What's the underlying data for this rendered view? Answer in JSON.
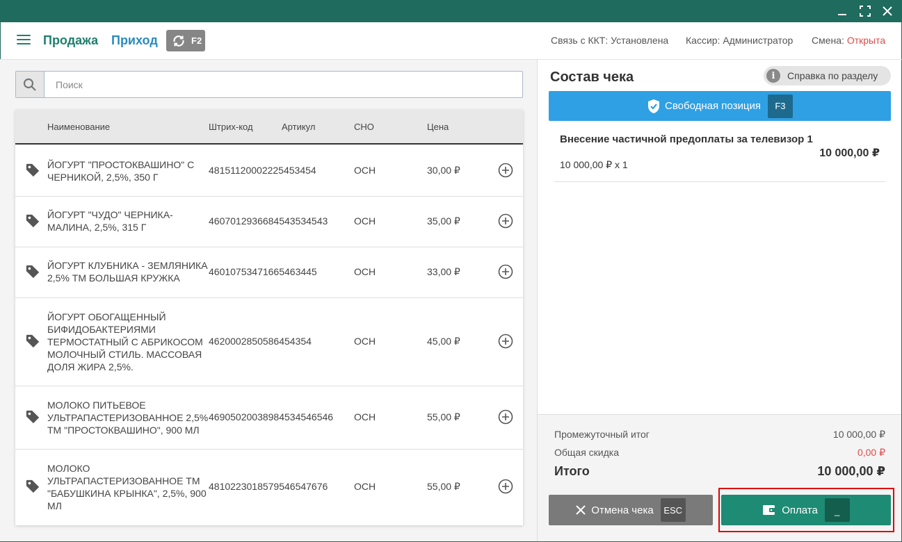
{
  "window": {
    "controls": {
      "minimize": "minimize-icon",
      "maximize": "maximize-icon",
      "close": "close-icon"
    }
  },
  "header": {
    "nav_sale": "Продажа",
    "nav_income": "Приход",
    "sync_key": "F2",
    "kkt_status": "Связь с ККТ: Установлена",
    "cashier": "Кассир: Администратор",
    "shift_label": "Смена:",
    "shift_value": "Открыта"
  },
  "search": {
    "placeholder": "Поиск"
  },
  "table": {
    "columns": [
      "Наименование",
      "Штрих-код",
      "Артикул",
      "СНО",
      "Цена"
    ],
    "rows": [
      {
        "name": "ЙОГУРТ \"ПРОСТОКВАШИНО\" С ЧЕРНИКОЙ, 2,5%, 350 Г",
        "barcode": "4815112000222545345​4",
        "sku": "",
        "tax": "ОСН",
        "price": "30,00 ₽"
      },
      {
        "name": "ЙОГУРТ \"ЧУДО\" ЧЕРНИКА-МАЛИНА, 2,5%, 315 Г",
        "barcode": "4607012936684543534543",
        "sku": "",
        "tax": "ОСН",
        "price": "35,00 ₽"
      },
      {
        "name": "ЙОГУРТ КЛУБНИКА - ЗЕМЛЯНИКА 2,5% ТМ БОЛЬШАЯ КРУЖКА",
        "barcode": "46010753471665463445",
        "sku": "",
        "tax": "ОСН",
        "price": "33,00 ₽"
      },
      {
        "name": "ЙОГУРТ ОБОГАЩЕННЫЙ БИФИДОБАКТЕРИЯМИ ТЕРМОСТАТНЫЙ С АБРИКОСОМ МОЛОЧНЫЙ СТИЛЬ. МАССОВАЯ ДОЛЯ ЖИРА 2,5%.",
        "barcode": "4620002850586454354",
        "sku": "",
        "tax": "ОСН",
        "price": "45,00 ₽"
      },
      {
        "name": "МОЛОКО ПИТЬЕВОЕ УЛЬТРАПАСТЕРИЗОВАННОЕ 2,5% ТМ \"ПРОСТОКВАШИНО\", 900 МЛ",
        "barcode": "4690502003898453454654​6",
        "sku": "",
        "tax": "ОСН",
        "price": "55,00 ₽"
      },
      {
        "name": "МОЛОКО УЛЬТРАПАСТЕРИЗОВАННОЕ ТМ \"БАБУШКИНА КРЫНКА\", 2,5%, 900 МЛ",
        "barcode": "4810223018579546547676",
        "sku": "",
        "tax": "ОСН",
        "price": "55,00 ₽"
      }
    ]
  },
  "receipt": {
    "title": "Состав чека",
    "help_label": "Справка по разделу",
    "free_position_label": "Свободная позиция",
    "free_position_key": "F3",
    "items": [
      {
        "name": "Внесение частичной предоплаты за телевизор 1",
        "qty_line": "10 000,00 ₽ x 1",
        "total": "10 000,00 ₽"
      }
    ],
    "subtotal_label": "Промежуточный итог",
    "subtotal_value": "10 000,00 ₽",
    "discount_label": "Общая скидка",
    "discount_value": "0,00 ₽",
    "total_label": "Итого",
    "total_value": "10 000,00 ₽",
    "cancel_label": "Отмена чека",
    "cancel_key": "ESC",
    "pay_label": "Оплата",
    "pay_key": "_"
  },
  "colors": {
    "titlebar": "#1f6b5d",
    "accent_green": "#1e8b74",
    "accent_blue": "#2fa0e4",
    "status_red": "#e04a4a",
    "highlight_red": "#e00000"
  }
}
